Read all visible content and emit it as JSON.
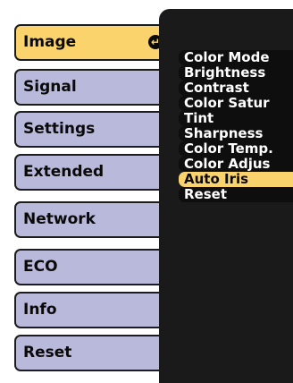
{
  "tabs": [
    {
      "label": "Image",
      "active": true
    },
    {
      "label": "Signal"
    },
    {
      "label": "Settings"
    },
    {
      "label": "Extended"
    },
    {
      "label": "Network"
    },
    {
      "label": "ECO"
    },
    {
      "label": "Info"
    },
    {
      "label": "Reset"
    }
  ],
  "enter_icon": "enter-return-icon",
  "submenu": [
    {
      "label": "Color Mode"
    },
    {
      "label": "Brightness"
    },
    {
      "label": "Contrast"
    },
    {
      "label": "Color Satur"
    },
    {
      "label": "Tint"
    },
    {
      "label": "Sharpness"
    },
    {
      "label": "Color Temp."
    },
    {
      "label": "Color Adjus"
    },
    {
      "label": "Auto Iris",
      "selected": true
    },
    {
      "label": "Reset"
    }
  ],
  "colors": {
    "tab_active": "#fbd36c",
    "tab_inactive": "#b9b9dc",
    "panel_bg": "#1a1a1a",
    "selected_item": "#fbd36c"
  }
}
